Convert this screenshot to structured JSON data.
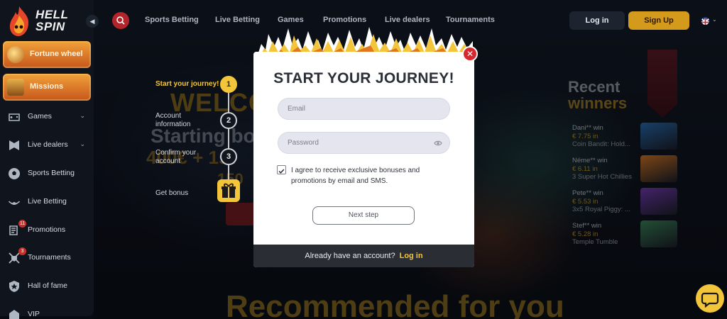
{
  "brand": {
    "name_line1": "HELL",
    "name_line2": "SPIN"
  },
  "sidebar": {
    "promo_tiles": [
      {
        "label": "Fortune wheel",
        "icon": "fortune-wheel-icon"
      },
      {
        "label": "Missions",
        "icon": "treasure-chest-icon"
      }
    ],
    "items": [
      {
        "label": "Games",
        "icon": "games-icon",
        "has_chevron": true,
        "badge": ""
      },
      {
        "label": "Live dealers",
        "icon": "live-dealer-icon",
        "has_chevron": true,
        "badge": ""
      },
      {
        "label": "Sports Betting",
        "icon": "soccer-ball-icon",
        "has_chevron": false,
        "badge": ""
      },
      {
        "label": "Live Betting",
        "icon": "live-signal-icon",
        "has_chevron": false,
        "badge": ""
      },
      {
        "label": "Promotions",
        "icon": "scroll-icon",
        "has_chevron": false,
        "badge": "11"
      },
      {
        "label": "Tournaments",
        "icon": "swords-shield-icon",
        "has_chevron": false,
        "badge": "3"
      },
      {
        "label": "Hall of fame",
        "icon": "shield-crest-icon",
        "has_chevron": false,
        "badge": ""
      },
      {
        "label": "VIP",
        "icon": "vip-icon",
        "has_chevron": false,
        "badge": ""
      }
    ]
  },
  "topnav": {
    "links": [
      "Sports Betting",
      "Live Betting",
      "Games",
      "Promotions",
      "Live dealers",
      "Tournaments"
    ],
    "login_label": "Log in",
    "signup_label": "Sign Up",
    "language_icon": "uk-flag-icon"
  },
  "hero": {
    "welcome": "WELCO",
    "starting": "Starting bo",
    "amount": "400€ + 1st",
    "free_spins": "150"
  },
  "steps": [
    {
      "number": "1",
      "label": "Start your journey!",
      "active": true
    },
    {
      "number": "2",
      "label": "Account information",
      "active": false
    },
    {
      "number": "3",
      "label": "Confirm your account",
      "active": false
    },
    {
      "number": "",
      "label": "Get bonus",
      "active": false
    }
  ],
  "modal": {
    "title": "START YOUR JOURNEY!",
    "email_placeholder": "Email",
    "password_placeholder": "Password",
    "consent_checked": true,
    "consent_text": "I agree to receive exclusive bonuses and promotions by email and SMS.",
    "next_label": "Next step",
    "footer_question": "Already have an account?",
    "footer_link": "Log in"
  },
  "recent_winners": {
    "title_line1": "Recent",
    "title_line2": "winners",
    "items": [
      {
        "name": "Dani** win",
        "amount": "€ 7.75 in",
        "game": "Coin Bandit: Hold...",
        "thumb_color": "#2a6fb8"
      },
      {
        "name": "Néme** win",
        "amount": "€ 6.11 in",
        "game": "3 Super Hot Chillies",
        "thumb_color": "#e07a1f"
      },
      {
        "name": "Pete** win",
        "amount": "€ 5.53 in",
        "game": "3x5 Royal Piggy: ...",
        "thumb_color": "#7a3bb8"
      },
      {
        "name": "Stef** win",
        "amount": "€ 5.28 in",
        "game": "Temple Tumble",
        "thumb_color": "#3d8a5a"
      }
    ]
  },
  "recommended_title": "Recommended for you",
  "colors": {
    "accent": "#f2c53a",
    "brand_red": "#d8282f",
    "sidebar_bg": "#10151d"
  }
}
